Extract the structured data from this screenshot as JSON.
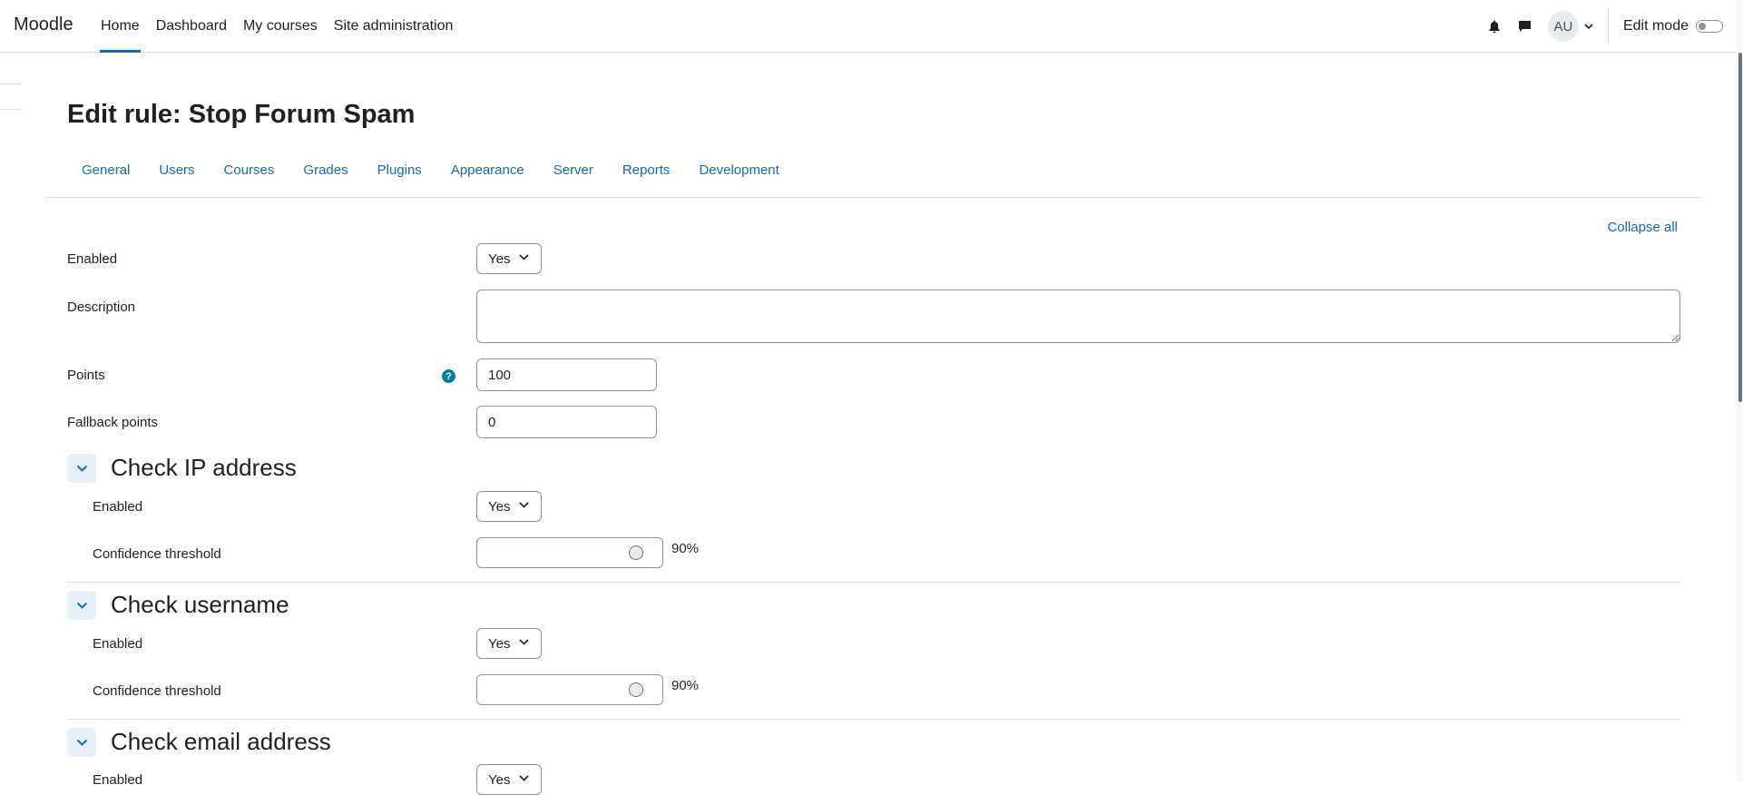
{
  "navbar": {
    "brand": "Moodle",
    "items": [
      {
        "label": "Home",
        "active": true
      },
      {
        "label": "Dashboard"
      },
      {
        "label": "My courses"
      },
      {
        "label": "Site administration"
      }
    ],
    "avatar_initials": "AU",
    "edit_mode_label": "Edit mode",
    "edit_mode_on": false
  },
  "page": {
    "title": "Edit rule: Stop Forum Spam"
  },
  "secondary_nav": {
    "tabs": [
      "General",
      "Users",
      "Courses",
      "Grades",
      "Plugins",
      "Appearance",
      "Server",
      "Reports",
      "Development"
    ]
  },
  "form": {
    "collapse_all": "Collapse all",
    "enabled": {
      "label": "Enabled",
      "value": "Yes"
    },
    "description": {
      "label": "Description",
      "value": ""
    },
    "points": {
      "label": "Points",
      "value": "100",
      "help_icon": "question-circle-icon"
    },
    "fallback_points": {
      "label": "Fallback points",
      "value": "0"
    },
    "sections": [
      {
        "title": "Check IP address",
        "enabled_label": "Enabled",
        "enabled_value": "Yes",
        "threshold_label": "Confidence threshold",
        "threshold_value": "90%",
        "threshold_fraction": 0.9
      },
      {
        "title": "Check username",
        "enabled_label": "Enabled",
        "enabled_value": "Yes",
        "threshold_label": "Confidence threshold",
        "threshold_value": "90%",
        "threshold_fraction": 0.9
      },
      {
        "title": "Check email address",
        "enabled_label": "Enabled",
        "enabled_value": "Yes"
      }
    ]
  },
  "colors": {
    "link": "#0f6cbf",
    "help": "#008196",
    "section_toggle_bg": "#e7f0f8"
  }
}
